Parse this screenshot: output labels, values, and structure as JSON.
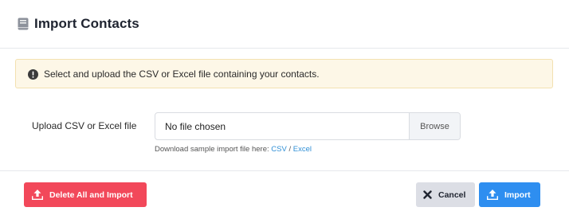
{
  "modal": {
    "title": "Import Contacts",
    "title_icon": "book-icon"
  },
  "alert": {
    "icon": "exclamation-circle-icon",
    "text": "Select and upload the CSV or Excel file containing your contacts."
  },
  "upload": {
    "label": "Upload CSV or Excel file",
    "file_value": "No file chosen",
    "browse_label": "Browse"
  },
  "sample": {
    "prefix": "Download sample import file here:",
    "csv_label": "CSV",
    "separator": "/",
    "excel_label": "Excel"
  },
  "footer": {
    "delete_import_label": "Delete All and Import",
    "cancel_label": "Cancel",
    "import_label": "Import"
  },
  "colors": {
    "danger": "#f2485a",
    "primary": "#2e8ef0",
    "alert_bg": "#fdf7e7",
    "link": "#2f8fd6"
  }
}
